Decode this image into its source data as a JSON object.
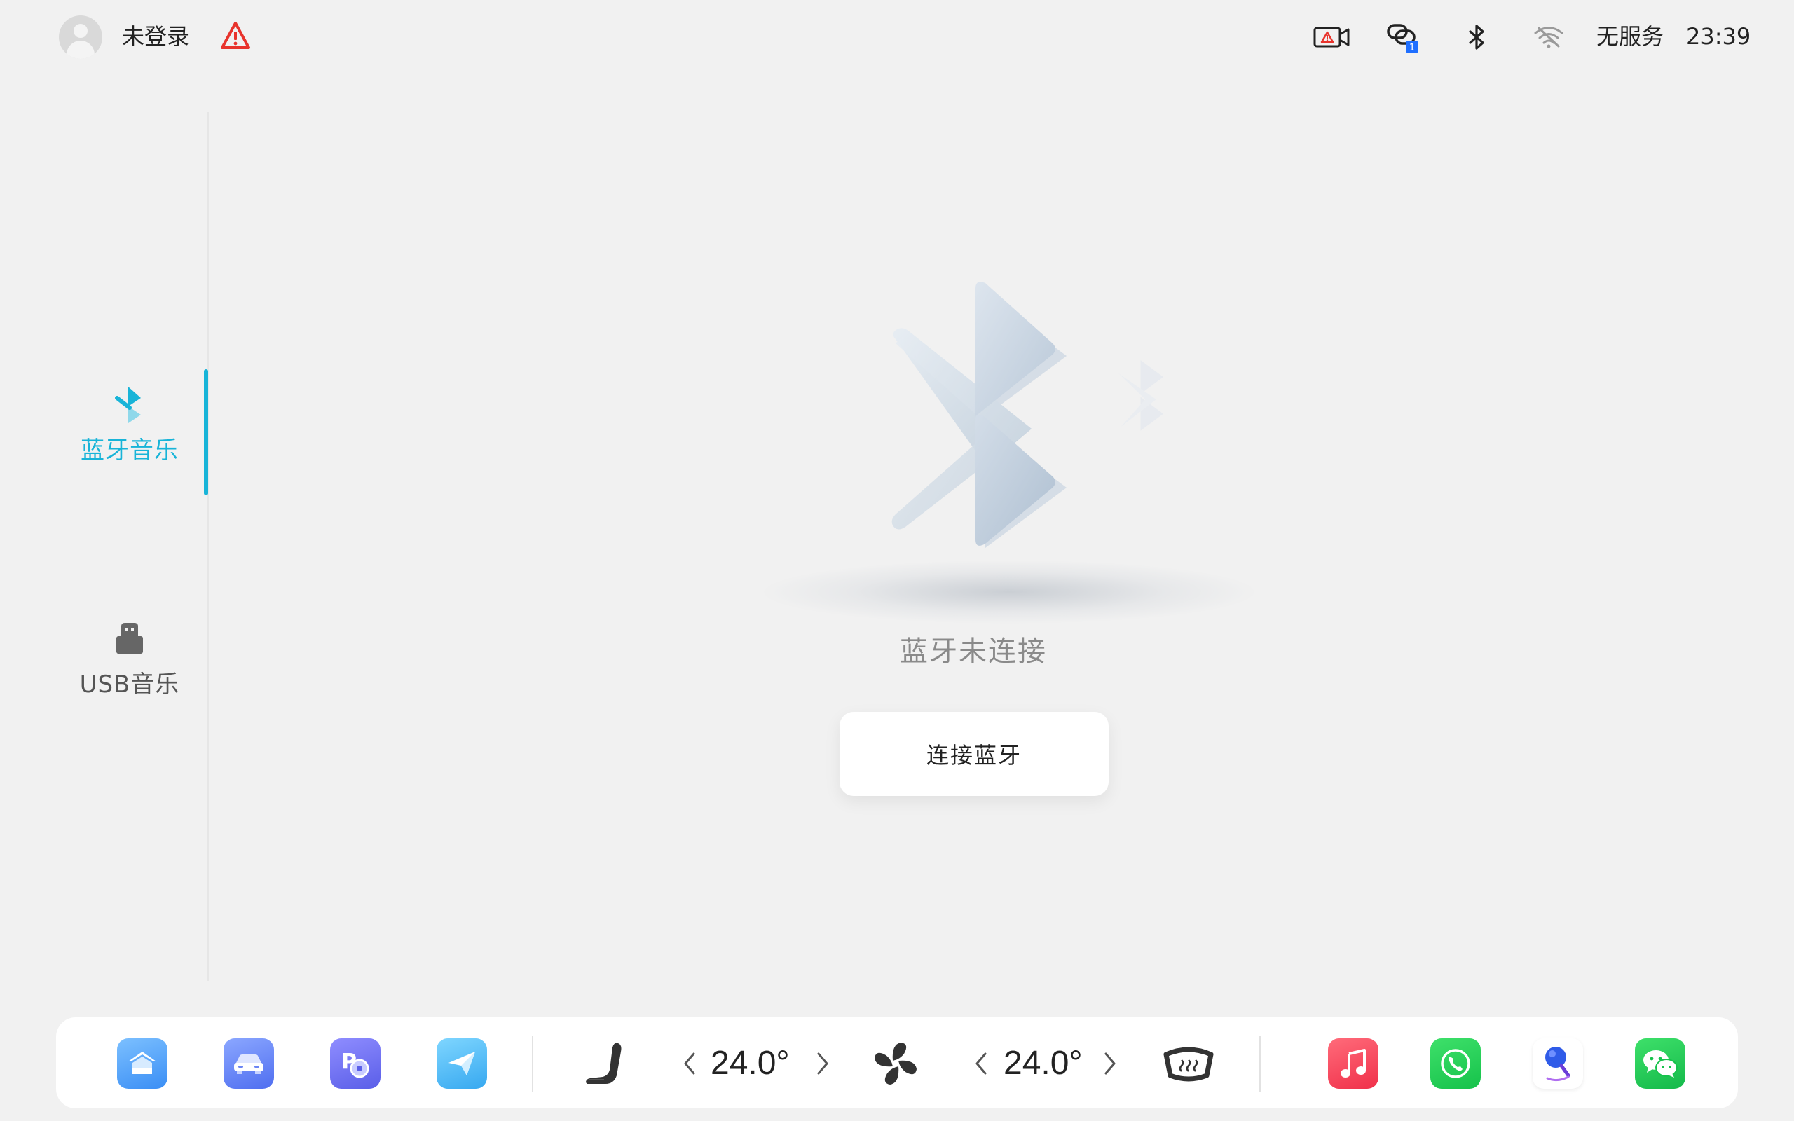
{
  "status_bar": {
    "login_status": "未登录",
    "service_status": "无服务",
    "time": "23:39",
    "link_badge_count": "1",
    "icons": [
      "avatar",
      "warning-icon",
      "dashcam-warning-icon",
      "phone-link-icon",
      "bluetooth-icon",
      "wifi-off-icon"
    ],
    "warning_color": "#e8332c",
    "badge_color": "#1f6fff"
  },
  "sidebar": {
    "active_color": "#18b4d8",
    "items": [
      {
        "label": "蓝牙音乐",
        "icon": "bluetooth-music-icon",
        "active": true
      },
      {
        "label": "USB音乐",
        "icon": "usb-icon",
        "active": false
      }
    ]
  },
  "main": {
    "empty_state_text": "蓝牙未连接",
    "connect_button_label": "连接蓝牙",
    "illustration": "bluetooth-illustration"
  },
  "dock": {
    "left_apps": [
      "home-app-icon",
      "vehicle-app-icon",
      "parking-app-icon",
      "navigation-app-icon"
    ],
    "climate": {
      "driver_temp": "24.0°",
      "passenger_temp": "24.0°",
      "icons": [
        "seat-icon",
        "fan-icon",
        "rear-defrost-icon"
      ]
    },
    "right_apps": [
      "music-app-icon",
      "phone-app-icon",
      "voice-assistant-app-icon",
      "wechat-app-icon"
    ]
  }
}
